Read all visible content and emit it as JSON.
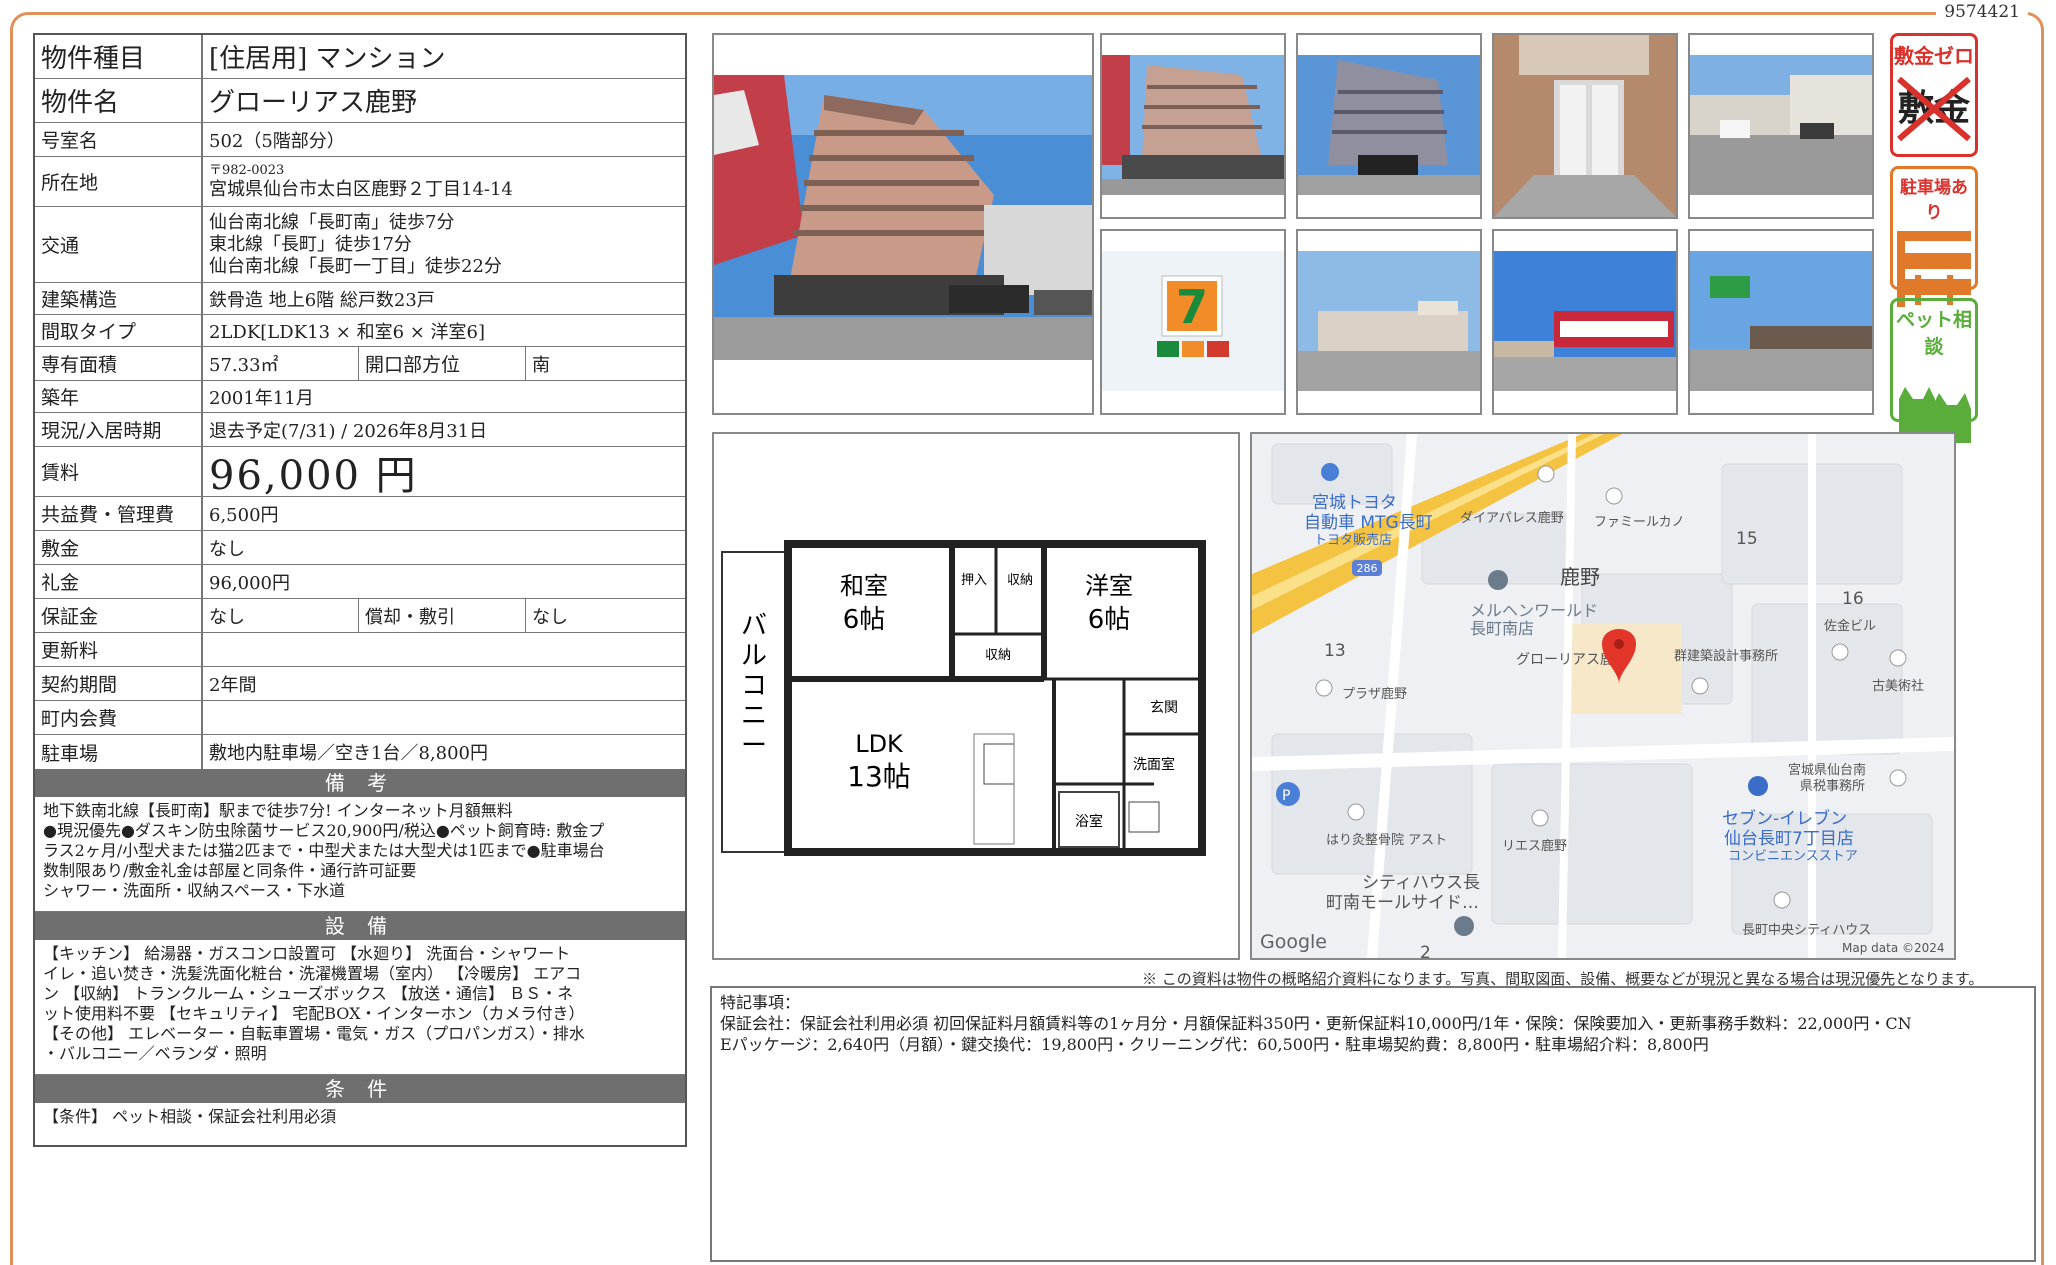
{
  "doc_id": "9574421",
  "spec": {
    "type_label": "物件種目",
    "type_value": "[住居用] マンション",
    "name_label": "物件名",
    "name_value": "グローリアス鹿野",
    "room_label": "号室名",
    "room_value": "502（5階部分）",
    "addr_label": "所在地",
    "addr_zip": "〒982-0023",
    "addr_value": "宮城県仙台市太白区鹿野２丁目14-14",
    "transport_label": "交通",
    "transport": [
      "仙台南北線「長町南」徒歩7分",
      "東北線「長町」徒歩17分",
      "仙台南北線「長町一丁目」徒歩22分"
    ],
    "structure_label": "建築構造",
    "structure_value": "鉄骨造 地上6階 総戸数23戸",
    "layout_label": "間取タイプ",
    "layout_value": "2LDK[LDK13 × 和室6 × 洋室6]",
    "area_label": "専有面積",
    "area_value": "57.33㎡",
    "direction_label": "開口部方位",
    "direction_value": "南",
    "built_label": "築年",
    "built_value": "2001年11月",
    "status_label": "現況/入居時期",
    "status_value": "退去予定(7/31) / 2026年8月31日",
    "rent_label": "賃料",
    "rent_value": "96,000 円",
    "fee_label": "共益費・管理費",
    "fee_value": "6,500円",
    "deposit_label": "敷金",
    "deposit_value": "なし",
    "keymoney_label": "礼金",
    "keymoney_value": "96,000円",
    "guarantee_label": "保証金",
    "guarantee_value": "なし",
    "amort_label": "償却・敷引",
    "amort_value": "なし",
    "renewal_label": "更新料",
    "renewal_value": "",
    "term_label": "契約期間",
    "term_value": "2年間",
    "assoc_label": "町内会費",
    "assoc_value": "",
    "parking_label": "駐車場",
    "parking_value": "敷地内駐車場／空き1台／8,800円"
  },
  "bikou": {
    "heading": "備 考",
    "lines": [
      "地下鉄南北線【長町南】駅まで徒歩7分! インターネット月額無料",
      "●現況優先●ダスキン防虫除菌サービス20,900円/税込●ペット飼育時: 敷金プ",
      "ラス2ヶ月/小型犬または猫2匹まで・中型犬または大型犬は1匹まで●駐車場台",
      "数制限あり/敷金礼金は部屋と同条件・通行許可証要",
      "シャワー・洗面所・収納スペース・下水道"
    ]
  },
  "setsubi": {
    "heading": "設 備",
    "lines": [
      "【キッチン】 給湯器・ガスコンロ設置可 【水廻り】 洗面台・シャワート",
      "イレ・追い焚き・洗髪洗面化粧台・洗濯機置場（室内） 【冷暖房】 エアコ",
      "ン 【収納】 トランクルーム・シューズボックス 【放送・通信】 ＢＳ・ネ",
      "ット使用料不要 【セキュリティ】 宅配BOX・インターホン（カメラ付き）",
      "【その他】 エレベーター・自転車置場・電気・ガス（プロパンガス）・排水",
      "・バルコニー／ベランダ・照明"
    ]
  },
  "jouken": {
    "heading": "条 件",
    "lines": [
      "【条件】 ペット相談・保証会社利用必須"
    ]
  },
  "badges": {
    "zero_title": "敷金ゼロ",
    "zero_word": "敷金",
    "parking_title": "駐車場あり",
    "pet_title": "ペット相談"
  },
  "colors": {
    "frame": "#e0905a",
    "badge_red": "#d9312b",
    "badge_orange": "#e07a2a",
    "badge_green": "#5aad3a",
    "header_gray": "#6f6f6f"
  },
  "floorplan": {
    "balcony": "バルコニー",
    "washitsu": "和室",
    "washitsu_size": "6帖",
    "youshitsu": "洋室",
    "youshitsu_size": "6帖",
    "oshiire": "押入",
    "shuno1": "収納",
    "shuno2": "収納",
    "ldk": "LDK",
    "ldk_size": "13帖",
    "genkan": "玄関",
    "sentaku": "洗面室",
    "yokushitsu": "浴室"
  },
  "map": {
    "labels": {
      "toyota": "宮城トヨタ",
      "toyota2": "自動車 MTG長町",
      "toyota3": "トヨタ販売店",
      "diapalace": "ダイアパレス鹿野",
      "family": "ファミールカノ",
      "kano": "鹿野",
      "n15": "15",
      "n16": "16",
      "n13": "13",
      "n2": "2",
      "road": "286",
      "marchen": "メルヘンワールド",
      "marchen2": "長町南店",
      "glorious": "グローリアス鹿野",
      "gun": "群建築設計事務所",
      "saka": "佐金ビル",
      "kobi": "古美術社",
      "plaza": "プラザ鹿野",
      "tax": "宮城県仙台南",
      "tax2": "県税事務所",
      "seven": "セブン-イレブン",
      "seven2": "仙台長町7丁目店",
      "seven3": "コンビニエンスストア",
      "hari": "はり灸整骨院 アスト",
      "rie": "リエス鹿野",
      "city": "シティハウス長",
      "city2": "町南モールサイド…",
      "chuo": "長町中央シティハウス",
      "google": "Google",
      "mapdata": "Map data ©2024"
    }
  },
  "notice": "※ この資料は物件の概略紹介資料になります。写真、間取図面、設備、概要などが現況と異なる場合は現況優先となります。",
  "remarks": {
    "title": "特記事項：",
    "line1": "保証会社：保証会社利用必須 初回保証料月額賃料等の1ヶ月分・月額保証料350円・更新保証料10,000円/1年・保険：保険要加入・更新事務手数料：22,000円・CN",
    "line2": "Eパッケージ：2,640円（月額）・鍵交換代：19,800円・クリーニング代：60,500円・駐車場契約費：8,800円・駐車場紹介料：8,800円"
  }
}
